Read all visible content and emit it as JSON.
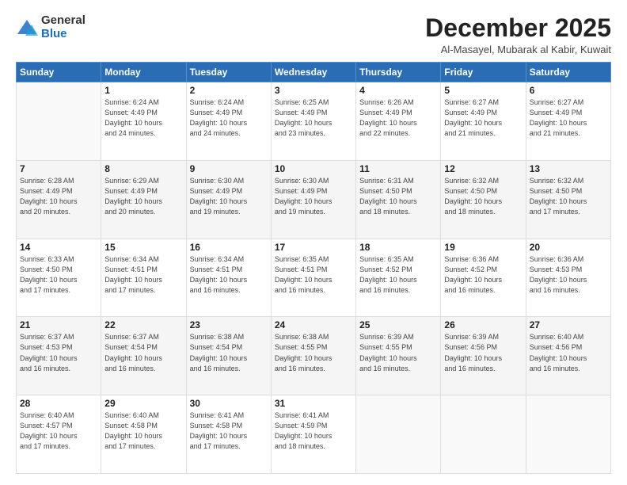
{
  "logo": {
    "general": "General",
    "blue": "Blue"
  },
  "title": "December 2025",
  "subtitle": "Al-Masayel, Mubarak al Kabir, Kuwait",
  "days_header": [
    "Sunday",
    "Monday",
    "Tuesday",
    "Wednesday",
    "Thursday",
    "Friday",
    "Saturday"
  ],
  "weeks": [
    [
      {
        "day": "",
        "info": ""
      },
      {
        "day": "1",
        "info": "Sunrise: 6:24 AM\nSunset: 4:49 PM\nDaylight: 10 hours\nand 24 minutes."
      },
      {
        "day": "2",
        "info": "Sunrise: 6:24 AM\nSunset: 4:49 PM\nDaylight: 10 hours\nand 24 minutes."
      },
      {
        "day": "3",
        "info": "Sunrise: 6:25 AM\nSunset: 4:49 PM\nDaylight: 10 hours\nand 23 minutes."
      },
      {
        "day": "4",
        "info": "Sunrise: 6:26 AM\nSunset: 4:49 PM\nDaylight: 10 hours\nand 22 minutes."
      },
      {
        "day": "5",
        "info": "Sunrise: 6:27 AM\nSunset: 4:49 PM\nDaylight: 10 hours\nand 21 minutes."
      },
      {
        "day": "6",
        "info": "Sunrise: 6:27 AM\nSunset: 4:49 PM\nDaylight: 10 hours\nand 21 minutes."
      }
    ],
    [
      {
        "day": "7",
        "info": "Sunrise: 6:28 AM\nSunset: 4:49 PM\nDaylight: 10 hours\nand 20 minutes."
      },
      {
        "day": "8",
        "info": "Sunrise: 6:29 AM\nSunset: 4:49 PM\nDaylight: 10 hours\nand 20 minutes."
      },
      {
        "day": "9",
        "info": "Sunrise: 6:30 AM\nSunset: 4:49 PM\nDaylight: 10 hours\nand 19 minutes."
      },
      {
        "day": "10",
        "info": "Sunrise: 6:30 AM\nSunset: 4:49 PM\nDaylight: 10 hours\nand 19 minutes."
      },
      {
        "day": "11",
        "info": "Sunrise: 6:31 AM\nSunset: 4:50 PM\nDaylight: 10 hours\nand 18 minutes."
      },
      {
        "day": "12",
        "info": "Sunrise: 6:32 AM\nSunset: 4:50 PM\nDaylight: 10 hours\nand 18 minutes."
      },
      {
        "day": "13",
        "info": "Sunrise: 6:32 AM\nSunset: 4:50 PM\nDaylight: 10 hours\nand 17 minutes."
      }
    ],
    [
      {
        "day": "14",
        "info": "Sunrise: 6:33 AM\nSunset: 4:50 PM\nDaylight: 10 hours\nand 17 minutes."
      },
      {
        "day": "15",
        "info": "Sunrise: 6:34 AM\nSunset: 4:51 PM\nDaylight: 10 hours\nand 17 minutes."
      },
      {
        "day": "16",
        "info": "Sunrise: 6:34 AM\nSunset: 4:51 PM\nDaylight: 10 hours\nand 16 minutes."
      },
      {
        "day": "17",
        "info": "Sunrise: 6:35 AM\nSunset: 4:51 PM\nDaylight: 10 hours\nand 16 minutes."
      },
      {
        "day": "18",
        "info": "Sunrise: 6:35 AM\nSunset: 4:52 PM\nDaylight: 10 hours\nand 16 minutes."
      },
      {
        "day": "19",
        "info": "Sunrise: 6:36 AM\nSunset: 4:52 PM\nDaylight: 10 hours\nand 16 minutes."
      },
      {
        "day": "20",
        "info": "Sunrise: 6:36 AM\nSunset: 4:53 PM\nDaylight: 10 hours\nand 16 minutes."
      }
    ],
    [
      {
        "day": "21",
        "info": "Sunrise: 6:37 AM\nSunset: 4:53 PM\nDaylight: 10 hours\nand 16 minutes."
      },
      {
        "day": "22",
        "info": "Sunrise: 6:37 AM\nSunset: 4:54 PM\nDaylight: 10 hours\nand 16 minutes."
      },
      {
        "day": "23",
        "info": "Sunrise: 6:38 AM\nSunset: 4:54 PM\nDaylight: 10 hours\nand 16 minutes."
      },
      {
        "day": "24",
        "info": "Sunrise: 6:38 AM\nSunset: 4:55 PM\nDaylight: 10 hours\nand 16 minutes."
      },
      {
        "day": "25",
        "info": "Sunrise: 6:39 AM\nSunset: 4:55 PM\nDaylight: 10 hours\nand 16 minutes."
      },
      {
        "day": "26",
        "info": "Sunrise: 6:39 AM\nSunset: 4:56 PM\nDaylight: 10 hours\nand 16 minutes."
      },
      {
        "day": "27",
        "info": "Sunrise: 6:40 AM\nSunset: 4:56 PM\nDaylight: 10 hours\nand 16 minutes."
      }
    ],
    [
      {
        "day": "28",
        "info": "Sunrise: 6:40 AM\nSunset: 4:57 PM\nDaylight: 10 hours\nand 17 minutes."
      },
      {
        "day": "29",
        "info": "Sunrise: 6:40 AM\nSunset: 4:58 PM\nDaylight: 10 hours\nand 17 minutes."
      },
      {
        "day": "30",
        "info": "Sunrise: 6:41 AM\nSunset: 4:58 PM\nDaylight: 10 hours\nand 17 minutes."
      },
      {
        "day": "31",
        "info": "Sunrise: 6:41 AM\nSunset: 4:59 PM\nDaylight: 10 hours\nand 18 minutes."
      },
      {
        "day": "",
        "info": ""
      },
      {
        "day": "",
        "info": ""
      },
      {
        "day": "",
        "info": ""
      }
    ]
  ]
}
